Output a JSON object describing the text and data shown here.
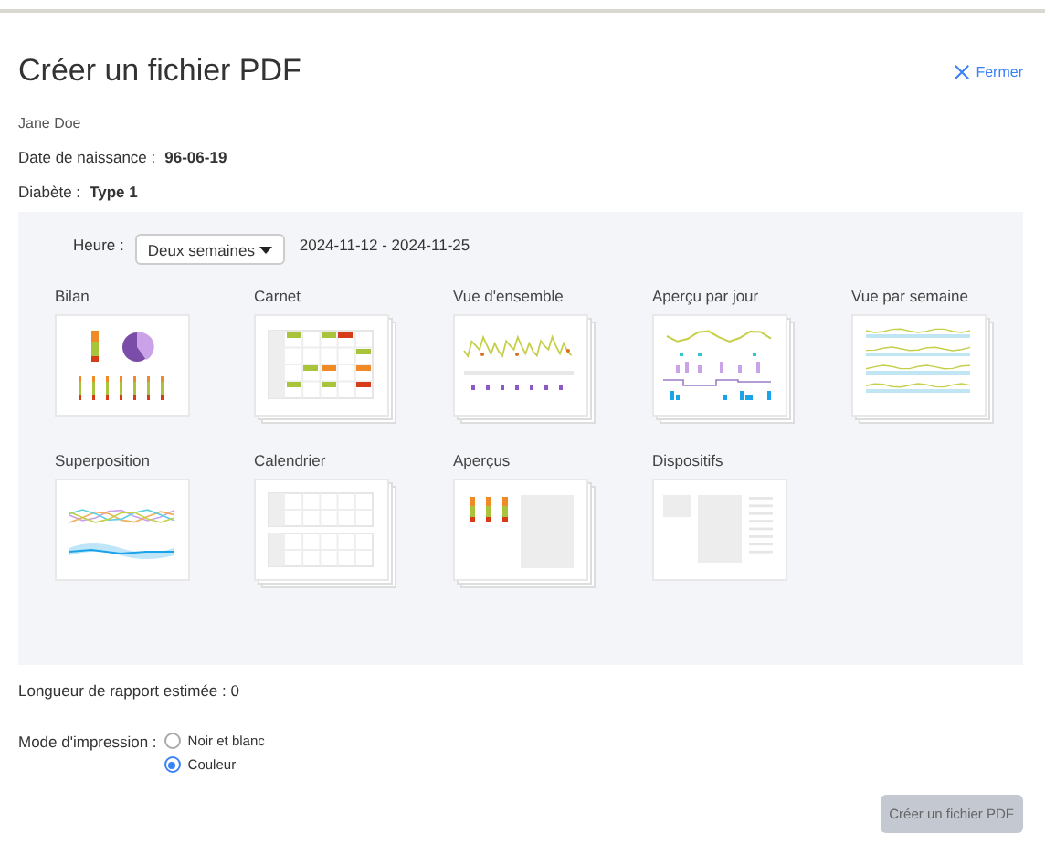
{
  "dialog": {
    "title": "Créer un fichier PDF",
    "close_label": "Fermer"
  },
  "patient": {
    "name": "Jane Doe",
    "fields": [
      {
        "label": "Date de naissance :",
        "value": "96-06-19"
      },
      {
        "label": "Diabète :",
        "value": "Type 1"
      }
    ]
  },
  "period": {
    "label": "Heure :",
    "select_value": "Deux semaines",
    "range": "2024-11-12 - 2024-11-25"
  },
  "reports": [
    {
      "label": "Bilan",
      "kind": "summary",
      "multipage": false
    },
    {
      "label": "Carnet",
      "kind": "logbook",
      "multipage": true
    },
    {
      "label": "Vue d'ensemble",
      "kind": "overview",
      "multipage": true
    },
    {
      "label": "Aperçu par jour",
      "kind": "daily",
      "multipage": true
    },
    {
      "label": "Vue par semaine",
      "kind": "weekly",
      "multipage": true
    },
    {
      "label": "Superposition",
      "kind": "overlay",
      "multipage": false
    },
    {
      "label": "Calendrier",
      "kind": "calendar",
      "multipage": true
    },
    {
      "label": "Aperçus",
      "kind": "snapshots",
      "multipage": true
    },
    {
      "label": "Dispositifs",
      "kind": "devices",
      "multipage": false
    }
  ],
  "estimate": "Longueur de rapport estimée : 0",
  "print_mode": {
    "label": "Mode d'impression :",
    "options": [
      {
        "label": "Noir et blanc",
        "selected": false
      },
      {
        "label": "Couleur",
        "selected": true
      }
    ]
  },
  "create_button": {
    "label": "Créer un fichier PDF",
    "disabled": true
  }
}
